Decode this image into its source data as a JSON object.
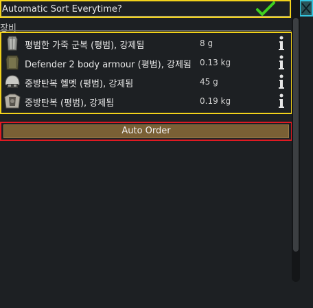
{
  "header": {
    "sort_label": "Automatic Sort Everytime?",
    "sort_checked": true
  },
  "section": {
    "label": "장비"
  },
  "items": [
    {
      "name": "평범한 가죽 군복 (평범), 강제됨",
      "weight": "8 g",
      "icon": "leather-uniform-icon"
    },
    {
      "name": "Defender 2 body armour (평범), 강제됨",
      "weight": "0.13 kg",
      "icon": "body-armour-icon"
    },
    {
      "name": "중방탄복 헬멧 (평범), 강제됨",
      "weight": "45 g",
      "icon": "helmet-icon"
    },
    {
      "name": "중방탄복 (평범), 강제됨",
      "weight": "0.19 kg",
      "icon": "heavy-vest-icon"
    }
  ],
  "actions": {
    "auto_order_label": "Auto Order"
  },
  "colors": {
    "highlight_yellow": "#f2d21b",
    "highlight_red": "#e01a22",
    "button_brown": "#7a6035",
    "check_green": "#3fcf1f",
    "close_cyan": "#34c6e0",
    "background": "#1d2023"
  }
}
